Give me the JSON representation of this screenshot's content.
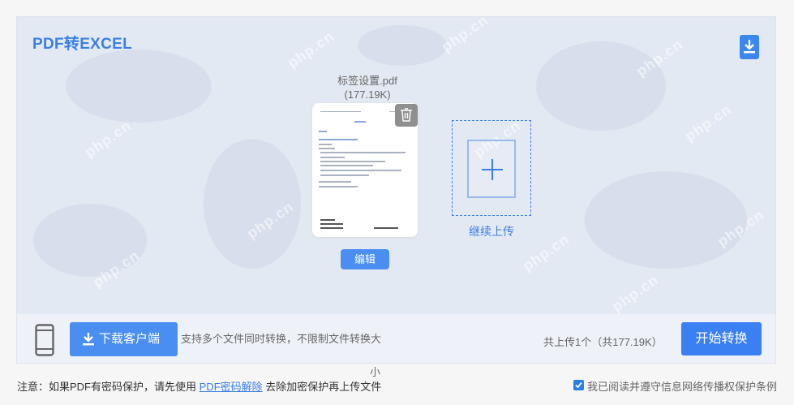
{
  "header": {
    "title": "PDF转EXCEL",
    "download_icon": "download-icon"
  },
  "file": {
    "name": "标签设置.pdf",
    "size": "(177.19K)",
    "delete_icon": "trash-icon",
    "edit_label": "编辑"
  },
  "upload": {
    "add_icon": "plus-icon",
    "continue_label": "继续上传"
  },
  "watermark": "php.cn",
  "bottom_bar": {
    "phone_icon": "phone-icon",
    "client_button_label": "下载客户端",
    "support_text": "支持多个文件同时转换，不限制文件转换大",
    "support_text_wrap": "小",
    "total_text": "共上传1个（共177.19K）",
    "start_button_label": "开始转换"
  },
  "footer": {
    "note_prefix": "注意：如果PDF有密码保护，请先使用",
    "note_link": "PDF密码解除",
    "note_suffix": "去除加密保护再上传文件",
    "agree_checked": true,
    "agree_label": "我已阅读并遵守信息网络传播权保护条例"
  },
  "colors": {
    "accent": "#3b7fe4",
    "button": "#4a8ef2",
    "panel_bg": "#e3e9f3"
  }
}
